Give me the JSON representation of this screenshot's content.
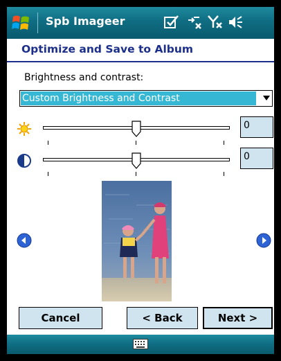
{
  "titlebar": {
    "app_name": "Spb Imageer"
  },
  "page": {
    "title": "Optimize and Save to Album"
  },
  "brightness_contrast": {
    "label": "Brightness and contrast:",
    "selected": "Custom Brightness and Contrast"
  },
  "sliders": {
    "brightness": {
      "value": "0",
      "level": 0.5,
      "icon": "sun-icon"
    },
    "contrast": {
      "value": "0",
      "level": 0.5,
      "icon": "contrast-icon"
    }
  },
  "buttons": {
    "cancel": "Cancel",
    "back": "< Back",
    "next": "Next >"
  },
  "colors": {
    "bar": "#0f6d82",
    "heading": "#1c2f8a",
    "select_highlight": "#36b8d4",
    "button_bg": "#cfe4ef",
    "nav_arrow": "#2e63d6"
  }
}
